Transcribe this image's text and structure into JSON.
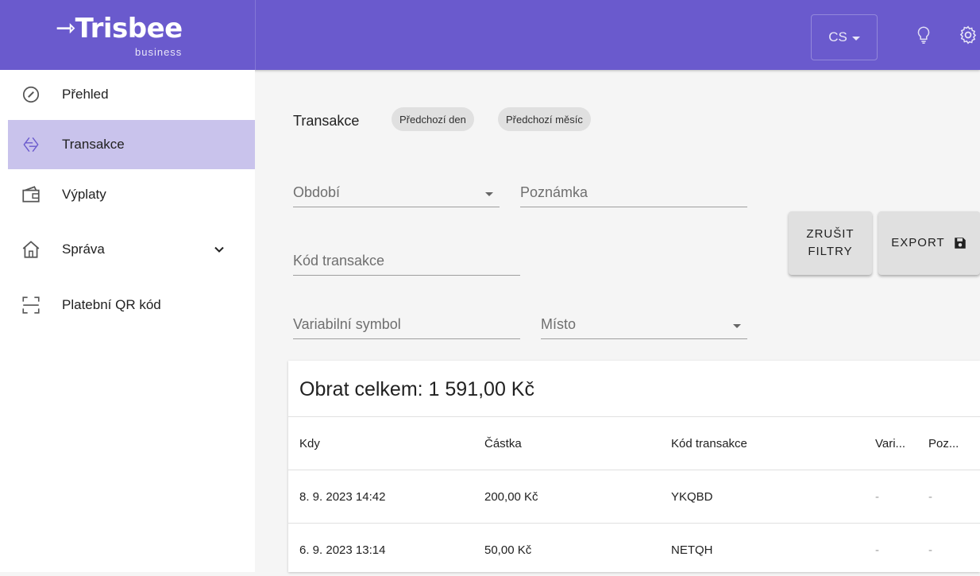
{
  "header": {
    "logo_text": "Trisbee",
    "logo_arrow": "⇾",
    "logo_sub": "business",
    "language": "CS",
    "icons": [
      "lightbulb-icon",
      "gear-icon"
    ],
    "brand_color": "#6a5acd"
  },
  "sidebar": {
    "items": [
      {
        "label": "Přehled",
        "icon": "speedometer-icon"
      },
      {
        "label": "Transakce",
        "icon": "swap-arrows-icon",
        "active": true
      },
      {
        "label": "Výplaty",
        "icon": "wallet-icon"
      },
      {
        "label": "Správa",
        "icon": "home-icon",
        "expandable": true
      },
      {
        "label": "Platební QR kód",
        "icon": "qr-scan-icon"
      }
    ],
    "active_color": "#c9c3ec"
  },
  "main": {
    "title": "Transakce",
    "chips": [
      "Předchozí den",
      "Předchozí měsíc"
    ],
    "filters": {
      "period": "Období",
      "note": "Poznámka",
      "transaction_code": "Kód transakce",
      "variable_symbol": "Variabilní symbol",
      "place": "Místo"
    },
    "buttons": {
      "clear_line1": "ZRUŠIT",
      "clear_line2": "FILTRY",
      "export": "EXPORT"
    },
    "total": "Obrat celkem: 1 591,00 Kč",
    "table": {
      "columns": [
        "Kdy",
        "Částka",
        "Kód transakce",
        "Vari...",
        "Poz..."
      ],
      "rows": [
        [
          "8. 9. 2023 14:42",
          "200,00 Kč",
          "YKQBD",
          "-",
          "-"
        ],
        [
          "6. 9. 2023 13:14",
          "50,00 Kč",
          "NETQH",
          "-",
          "-"
        ]
      ]
    }
  }
}
